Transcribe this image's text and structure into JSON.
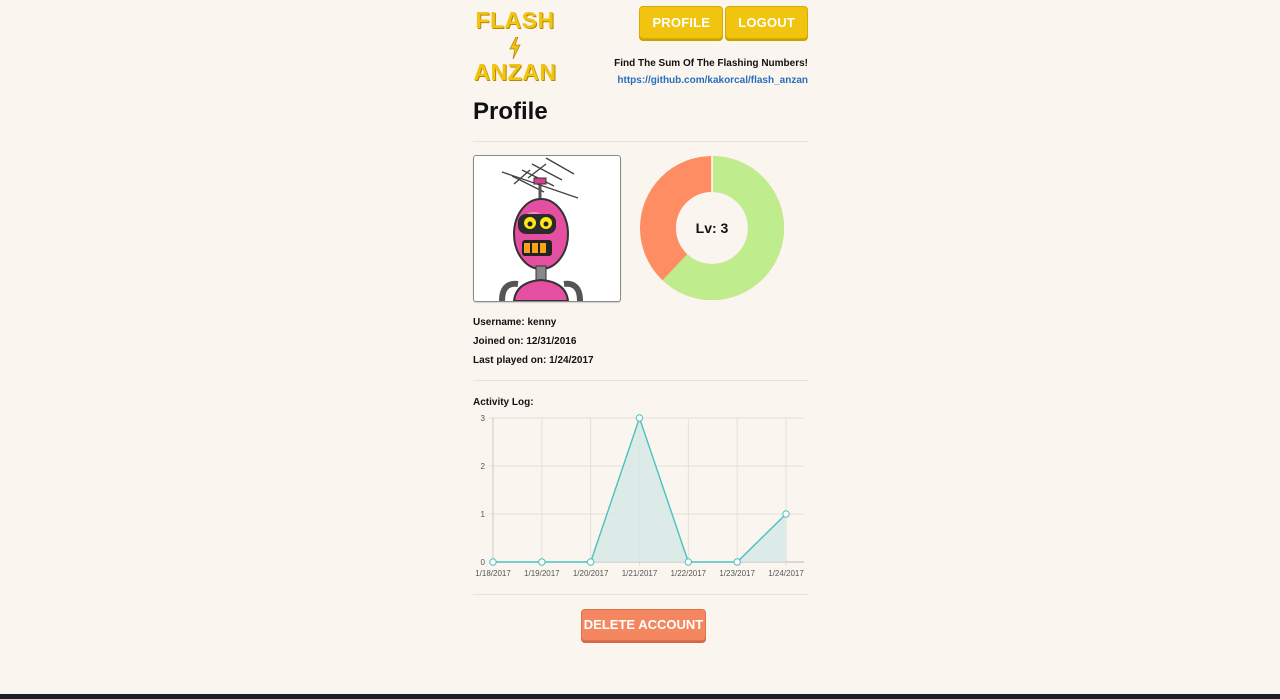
{
  "logo": {
    "line1": "FLASH",
    "line2": "ANZAN",
    "icon": "lightning-bolt-icon",
    "color": "#f1c40f"
  },
  "nav": {
    "profile_label": "PROFILE",
    "logout_label": "LOGOUT"
  },
  "header": {
    "tagline": "Find The Sum Of The Flashing Numbers!",
    "repo_link": "https://github.com/kakorcal/flash_anzan"
  },
  "page": {
    "title": "Profile"
  },
  "profile": {
    "avatar_icon": "robot-avatar-icon",
    "level_label": "Lv: 3",
    "level_progress": 0.62,
    "level_colors": {
      "progress": "#bfed8d",
      "remaining": "#ff8d64"
    },
    "username_line": "Username: kenny",
    "joined_line": "Joined on: 12/31/2016",
    "last_played_line": "Last played on: 1/24/2017"
  },
  "activity": {
    "label": "Activity Log:"
  },
  "chart_data": {
    "type": "area",
    "categories": [
      "1/18/2017",
      "1/19/2017",
      "1/20/2017",
      "1/21/2017",
      "1/22/2017",
      "1/23/2017",
      "1/24/2017"
    ],
    "series": [
      {
        "values": [
          0,
          0,
          0,
          3,
          0,
          0,
          1
        ]
      }
    ],
    "yticks": [
      "0",
      "1",
      "2",
      "3"
    ],
    "ylim": [
      0,
      3
    ],
    "grid": true,
    "line_color": "#4bc0c0",
    "fill_color": "#d6e9e6"
  },
  "actions": {
    "delete_label": "DELETE ACCOUNT",
    "delete_color": "#f4875f"
  }
}
